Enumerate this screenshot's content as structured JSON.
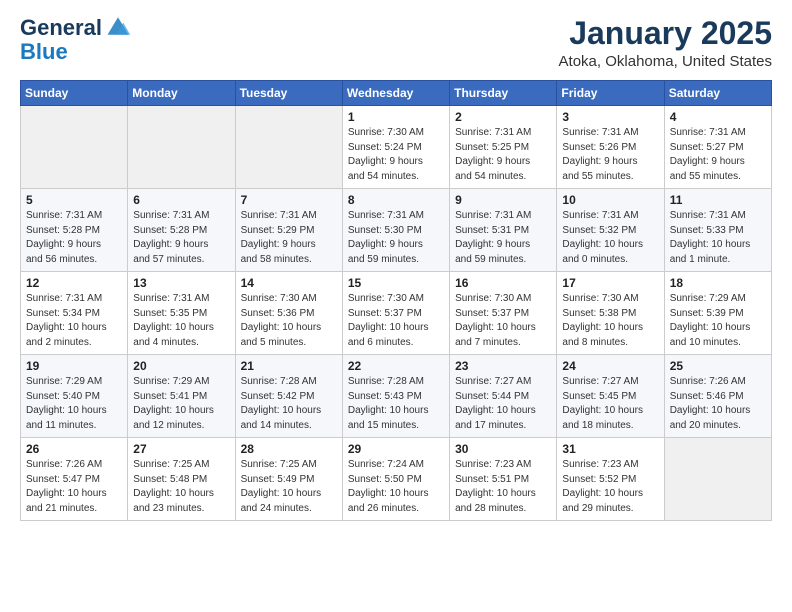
{
  "header": {
    "logo_line1": "General",
    "logo_line2": "Blue",
    "month": "January 2025",
    "location": "Atoka, Oklahoma, United States"
  },
  "weekdays": [
    "Sunday",
    "Monday",
    "Tuesday",
    "Wednesday",
    "Thursday",
    "Friday",
    "Saturday"
  ],
  "weeks": [
    [
      {
        "day": "",
        "info": ""
      },
      {
        "day": "",
        "info": ""
      },
      {
        "day": "",
        "info": ""
      },
      {
        "day": "1",
        "info": "Sunrise: 7:30 AM\nSunset: 5:24 PM\nDaylight: 9 hours\nand 54 minutes."
      },
      {
        "day": "2",
        "info": "Sunrise: 7:31 AM\nSunset: 5:25 PM\nDaylight: 9 hours\nand 54 minutes."
      },
      {
        "day": "3",
        "info": "Sunrise: 7:31 AM\nSunset: 5:26 PM\nDaylight: 9 hours\nand 55 minutes."
      },
      {
        "day": "4",
        "info": "Sunrise: 7:31 AM\nSunset: 5:27 PM\nDaylight: 9 hours\nand 55 minutes."
      }
    ],
    [
      {
        "day": "5",
        "info": "Sunrise: 7:31 AM\nSunset: 5:28 PM\nDaylight: 9 hours\nand 56 minutes."
      },
      {
        "day": "6",
        "info": "Sunrise: 7:31 AM\nSunset: 5:28 PM\nDaylight: 9 hours\nand 57 minutes."
      },
      {
        "day": "7",
        "info": "Sunrise: 7:31 AM\nSunset: 5:29 PM\nDaylight: 9 hours\nand 58 minutes."
      },
      {
        "day": "8",
        "info": "Sunrise: 7:31 AM\nSunset: 5:30 PM\nDaylight: 9 hours\nand 59 minutes."
      },
      {
        "day": "9",
        "info": "Sunrise: 7:31 AM\nSunset: 5:31 PM\nDaylight: 9 hours\nand 59 minutes."
      },
      {
        "day": "10",
        "info": "Sunrise: 7:31 AM\nSunset: 5:32 PM\nDaylight: 10 hours\nand 0 minutes."
      },
      {
        "day": "11",
        "info": "Sunrise: 7:31 AM\nSunset: 5:33 PM\nDaylight: 10 hours\nand 1 minute."
      }
    ],
    [
      {
        "day": "12",
        "info": "Sunrise: 7:31 AM\nSunset: 5:34 PM\nDaylight: 10 hours\nand 2 minutes."
      },
      {
        "day": "13",
        "info": "Sunrise: 7:31 AM\nSunset: 5:35 PM\nDaylight: 10 hours\nand 4 minutes."
      },
      {
        "day": "14",
        "info": "Sunrise: 7:30 AM\nSunset: 5:36 PM\nDaylight: 10 hours\nand 5 minutes."
      },
      {
        "day": "15",
        "info": "Sunrise: 7:30 AM\nSunset: 5:37 PM\nDaylight: 10 hours\nand 6 minutes."
      },
      {
        "day": "16",
        "info": "Sunrise: 7:30 AM\nSunset: 5:37 PM\nDaylight: 10 hours\nand 7 minutes."
      },
      {
        "day": "17",
        "info": "Sunrise: 7:30 AM\nSunset: 5:38 PM\nDaylight: 10 hours\nand 8 minutes."
      },
      {
        "day": "18",
        "info": "Sunrise: 7:29 AM\nSunset: 5:39 PM\nDaylight: 10 hours\nand 10 minutes."
      }
    ],
    [
      {
        "day": "19",
        "info": "Sunrise: 7:29 AM\nSunset: 5:40 PM\nDaylight: 10 hours\nand 11 minutes."
      },
      {
        "day": "20",
        "info": "Sunrise: 7:29 AM\nSunset: 5:41 PM\nDaylight: 10 hours\nand 12 minutes."
      },
      {
        "day": "21",
        "info": "Sunrise: 7:28 AM\nSunset: 5:42 PM\nDaylight: 10 hours\nand 14 minutes."
      },
      {
        "day": "22",
        "info": "Sunrise: 7:28 AM\nSunset: 5:43 PM\nDaylight: 10 hours\nand 15 minutes."
      },
      {
        "day": "23",
        "info": "Sunrise: 7:27 AM\nSunset: 5:44 PM\nDaylight: 10 hours\nand 17 minutes."
      },
      {
        "day": "24",
        "info": "Sunrise: 7:27 AM\nSunset: 5:45 PM\nDaylight: 10 hours\nand 18 minutes."
      },
      {
        "day": "25",
        "info": "Sunrise: 7:26 AM\nSunset: 5:46 PM\nDaylight: 10 hours\nand 20 minutes."
      }
    ],
    [
      {
        "day": "26",
        "info": "Sunrise: 7:26 AM\nSunset: 5:47 PM\nDaylight: 10 hours\nand 21 minutes."
      },
      {
        "day": "27",
        "info": "Sunrise: 7:25 AM\nSunset: 5:48 PM\nDaylight: 10 hours\nand 23 minutes."
      },
      {
        "day": "28",
        "info": "Sunrise: 7:25 AM\nSunset: 5:49 PM\nDaylight: 10 hours\nand 24 minutes."
      },
      {
        "day": "29",
        "info": "Sunrise: 7:24 AM\nSunset: 5:50 PM\nDaylight: 10 hours\nand 26 minutes."
      },
      {
        "day": "30",
        "info": "Sunrise: 7:23 AM\nSunset: 5:51 PM\nDaylight: 10 hours\nand 28 minutes."
      },
      {
        "day": "31",
        "info": "Sunrise: 7:23 AM\nSunset: 5:52 PM\nDaylight: 10 hours\nand 29 minutes."
      },
      {
        "day": "",
        "info": ""
      }
    ]
  ]
}
